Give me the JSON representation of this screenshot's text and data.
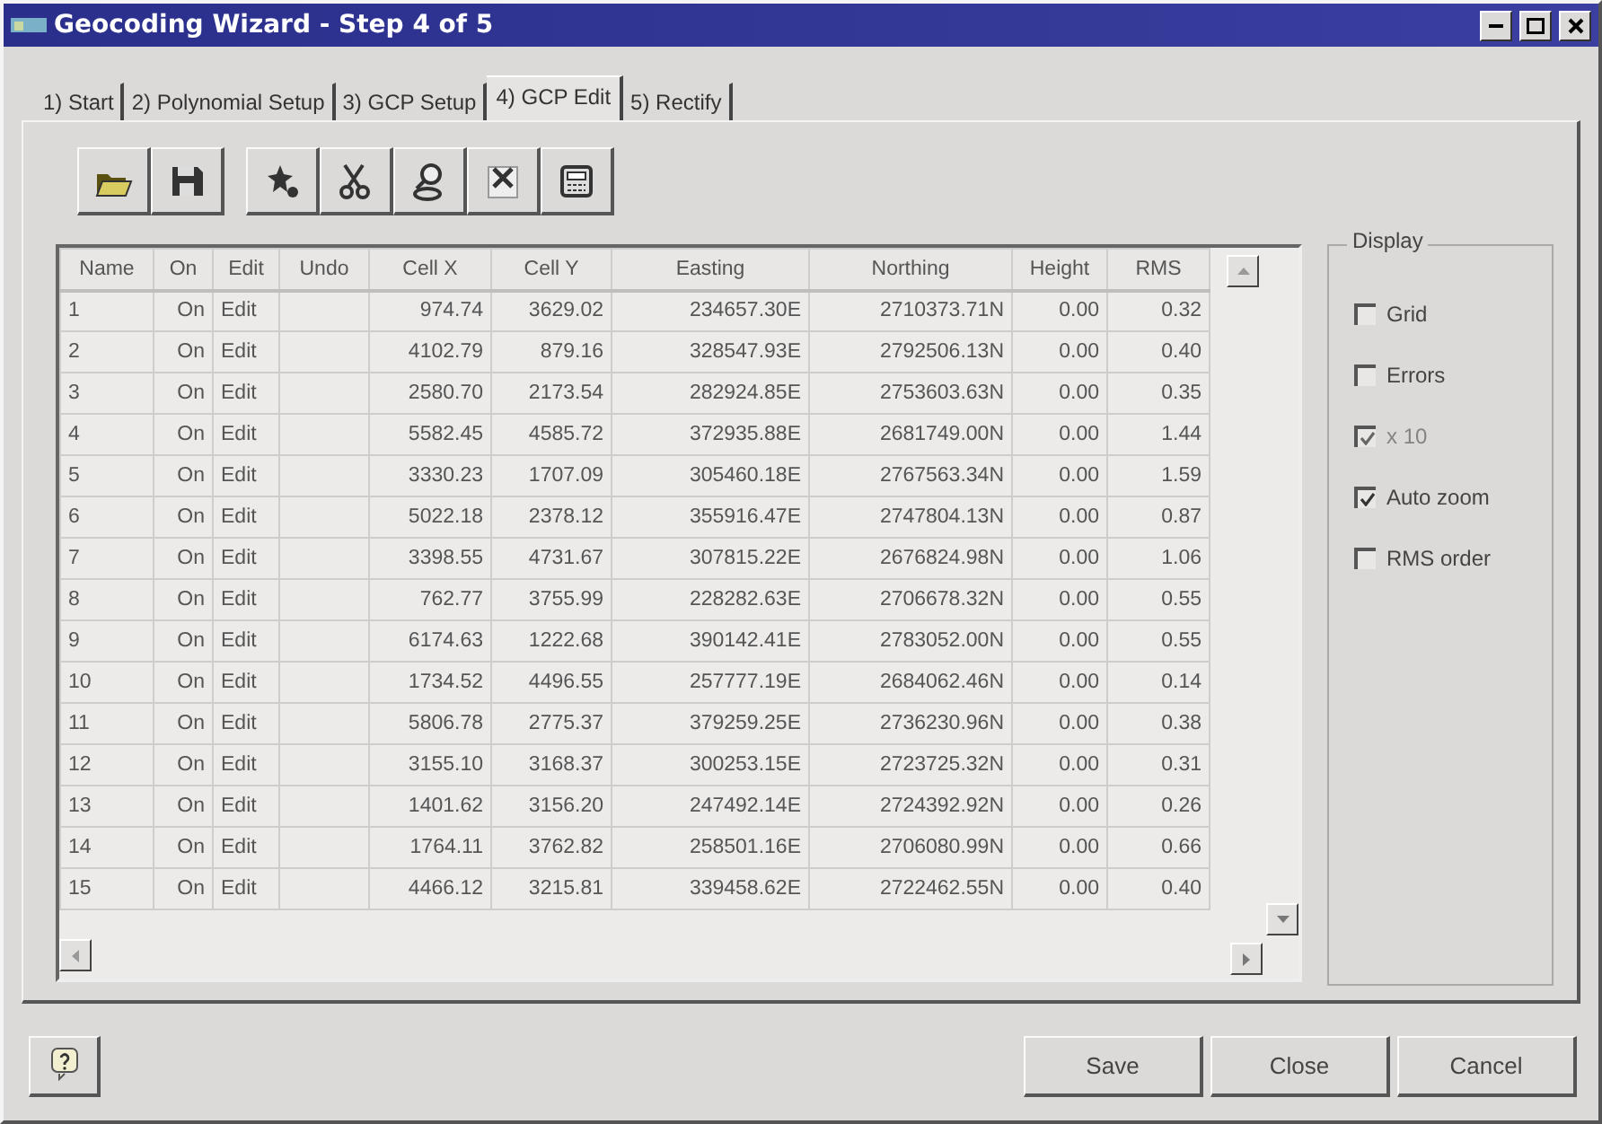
{
  "window": {
    "title": "Geocoding Wizard - Step 4 of 5"
  },
  "tabs": [
    {
      "label": "1) Start",
      "selected": false
    },
    {
      "label": "2) Polynomial Setup",
      "selected": false
    },
    {
      "label": "3) GCP Setup",
      "selected": false
    },
    {
      "label": "4) GCP Edit",
      "selected": true
    },
    {
      "label": "5) Rectify",
      "selected": false
    }
  ],
  "table": {
    "columns": [
      "Name",
      "On",
      "Edit",
      "Undo",
      "Cell X",
      "Cell Y",
      "Easting",
      "Northing",
      "Height",
      "RMS"
    ],
    "rows": [
      [
        "1",
        "On",
        "Edit",
        "",
        "974.74",
        "3629.02",
        "234657.30E",
        "2710373.71N",
        "0.00",
        "0.32"
      ],
      [
        "2",
        "On",
        "Edit",
        "",
        "4102.79",
        "879.16",
        "328547.93E",
        "2792506.13N",
        "0.00",
        "0.40"
      ],
      [
        "3",
        "On",
        "Edit",
        "",
        "2580.70",
        "2173.54",
        "282924.85E",
        "2753603.63N",
        "0.00",
        "0.35"
      ],
      [
        "4",
        "On",
        "Edit",
        "",
        "5582.45",
        "4585.72",
        "372935.88E",
        "2681749.00N",
        "0.00",
        "1.44"
      ],
      [
        "5",
        "On",
        "Edit",
        "",
        "3330.23",
        "1707.09",
        "305460.18E",
        "2767563.34N",
        "0.00",
        "1.59"
      ],
      [
        "6",
        "On",
        "Edit",
        "",
        "5022.18",
        "2378.12",
        "355916.47E",
        "2747804.13N",
        "0.00",
        "0.87"
      ],
      [
        "7",
        "On",
        "Edit",
        "",
        "3398.55",
        "4731.67",
        "307815.22E",
        "2676824.98N",
        "0.00",
        "1.06"
      ],
      [
        "8",
        "On",
        "Edit",
        "",
        "762.77",
        "3755.99",
        "228282.63E",
        "2706678.32N",
        "0.00",
        "0.55"
      ],
      [
        "9",
        "On",
        "Edit",
        "",
        "6174.63",
        "1222.68",
        "390142.41E",
        "2783052.00N",
        "0.00",
        "0.55"
      ],
      [
        "10",
        "On",
        "Edit",
        "",
        "1734.52",
        "4496.55",
        "257777.19E",
        "2684062.46N",
        "0.00",
        "0.14"
      ],
      [
        "11",
        "On",
        "Edit",
        "",
        "5806.78",
        "2775.37",
        "379259.25E",
        "2736230.96N",
        "0.00",
        "0.38"
      ],
      [
        "12",
        "On",
        "Edit",
        "",
        "3155.10",
        "3168.37",
        "300253.15E",
        "2723725.32N",
        "0.00",
        "0.31"
      ],
      [
        "13",
        "On",
        "Edit",
        "",
        "1401.62",
        "3156.20",
        "247492.14E",
        "2724392.92N",
        "0.00",
        "0.26"
      ],
      [
        "14",
        "On",
        "Edit",
        "",
        "1764.11",
        "3762.82",
        "258501.16E",
        "2706080.99N",
        "0.00",
        "0.66"
      ],
      [
        "15",
        "On",
        "Edit",
        "",
        "4466.12",
        "3215.81",
        "339458.62E",
        "2722462.55N",
        "0.00",
        "0.40"
      ]
    ]
  },
  "display": {
    "title": "Display",
    "options": [
      {
        "label": "Grid",
        "checked": false,
        "disabled": false
      },
      {
        "label": "Errors",
        "checked": false,
        "disabled": false
      },
      {
        "label": "x 10",
        "checked": true,
        "disabled": true
      },
      {
        "label": "Auto zoom",
        "checked": true,
        "disabled": false
      },
      {
        "label": "RMS order",
        "checked": false,
        "disabled": false
      }
    ]
  },
  "buttons": [
    "Save",
    "Close",
    "Cancel"
  ]
}
